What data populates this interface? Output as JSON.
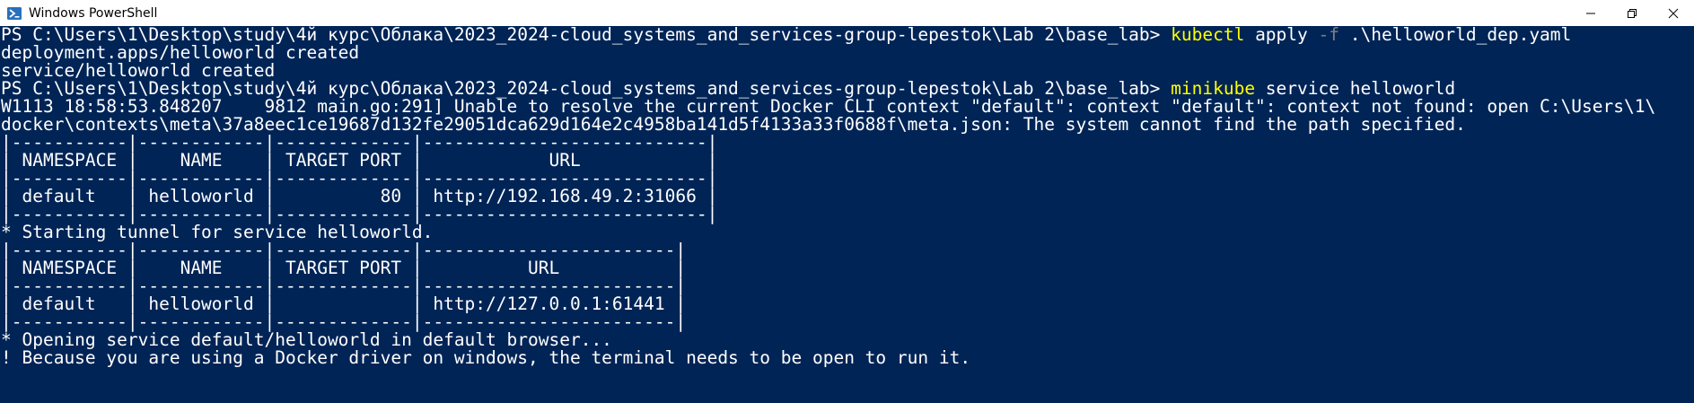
{
  "window": {
    "title": "Windows PowerShell",
    "icon": "powershell-icon",
    "controls": [
      "minimize-icon",
      "restore-icon",
      "close-icon"
    ]
  },
  "colors": {
    "background": "#012456",
    "text": "#ffffff",
    "command": "#ffff00",
    "parameter": "#808080"
  },
  "terminal": {
    "lines": [
      [
        {
          "t": "PS C:\\Users\\1\\Desktop\\study\\4й курс\\Облака\\2023_2024-cloud_systems_and_services-group-lepestok\\Lab 2\\base_lab> ",
          "c": "text"
        },
        {
          "t": "kubectl",
          "c": "cmd"
        },
        {
          "t": " apply ",
          "c": "text"
        },
        {
          "t": "-f",
          "c": "param"
        },
        {
          "t": " .\\helloworld_dep.yaml",
          "c": "text"
        }
      ],
      [
        {
          "t": "deployment.apps/helloworld created",
          "c": "text"
        }
      ],
      [
        {
          "t": "service/helloworld created",
          "c": "text"
        }
      ],
      [
        {
          "t": "PS C:\\Users\\1\\Desktop\\study\\4й курс\\Облака\\2023_2024-cloud_systems_and_services-group-lepestok\\Lab 2\\base_lab> ",
          "c": "text"
        },
        {
          "t": "minikube",
          "c": "cmd"
        },
        {
          "t": " service helloworld",
          "c": "text"
        }
      ],
      [
        {
          "t": "W1113 18:58:53.848207    9812 main.go:291] Unable to resolve the current Docker CLI context \"default\": context \"default\": context not found: open C:\\Users\\1\\",
          "c": "text"
        }
      ],
      [
        {
          "t": "docker\\contexts\\meta\\37a8eec1ce19687d132fe29051dca629d164e2c4958ba141d5f4133a33f0688f\\meta.json: The system cannot find the path specified.",
          "c": "text"
        }
      ],
      [
        {
          "t": "|-----------|------------|-------------|---------------------------|",
          "c": "text"
        }
      ],
      [
        {
          "t": "| NAMESPACE |    NAME    | TARGET PORT |            URL            |",
          "c": "text"
        }
      ],
      [
        {
          "t": "|-----------|------------|-------------|---------------------------|",
          "c": "text"
        }
      ],
      [
        {
          "t": "| default   | helloworld |          80 | http://192.168.49.2:31066 |",
          "c": "text"
        }
      ],
      [
        {
          "t": "|-----------|------------|-------------|---------------------------|",
          "c": "text"
        }
      ],
      [
        {
          "t": "* Starting tunnel for service helloworld.",
          "c": "text"
        }
      ],
      [
        {
          "t": "|-----------|------------|-------------|------------------------|",
          "c": "text"
        }
      ],
      [
        {
          "t": "| NAMESPACE |    NAME    | TARGET PORT |          URL           |",
          "c": "text"
        }
      ],
      [
        {
          "t": "|-----------|------------|-------------|------------------------|",
          "c": "text"
        }
      ],
      [
        {
          "t": "| default   | helloworld |             | http://127.0.0.1:61441 |",
          "c": "text"
        }
      ],
      [
        {
          "t": "|-----------|------------|-------------|------------------------|",
          "c": "text"
        }
      ],
      [
        {
          "t": "* Opening service default/helloworld in default browser...",
          "c": "text"
        }
      ],
      [
        {
          "t": "! Because you are using a Docker driver on windows, the terminal needs to be open to run it.",
          "c": "text"
        }
      ]
    ]
  }
}
